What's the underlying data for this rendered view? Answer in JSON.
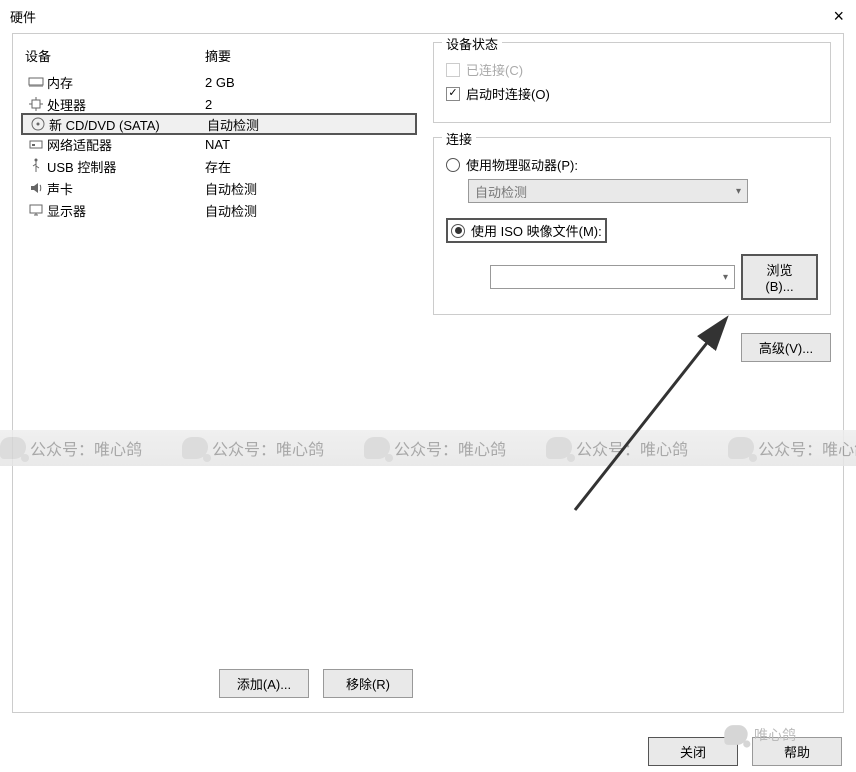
{
  "window": {
    "title": "硬件",
    "close": "×"
  },
  "deviceTable": {
    "head_device": "设备",
    "head_summary": "摘要",
    "rows": [
      {
        "icon": "memory-icon",
        "name": "内存",
        "summary": "2 GB"
      },
      {
        "icon": "cpu-icon",
        "name": "处理器",
        "summary": "2"
      },
      {
        "icon": "disc-icon",
        "name": "新 CD/DVD (SATA)",
        "summary": "自动检测",
        "selected": true
      },
      {
        "icon": "network-icon",
        "name": "网络适配器",
        "summary": "NAT"
      },
      {
        "icon": "usb-icon",
        "name": "USB 控制器",
        "summary": "存在"
      },
      {
        "icon": "sound-icon",
        "name": "声卡",
        "summary": "自动检测"
      },
      {
        "icon": "display-icon",
        "name": "显示器",
        "summary": "自动检测"
      }
    ]
  },
  "leftButtons": {
    "add": "添加(A)...",
    "remove": "移除(R)"
  },
  "status": {
    "legend": "设备状态",
    "connected": "已连接(C)",
    "connect_at_poweron": "启动时连接(O)"
  },
  "connection": {
    "legend": "连接",
    "use_physical": "使用物理驱动器(P):",
    "physical_combo": "自动检测",
    "use_iso": "使用 ISO 映像文件(M):",
    "iso_path": "",
    "browse": "浏览(B)..."
  },
  "advanced": "高级(V)...",
  "bottom": {
    "close": "关闭",
    "help": "帮助"
  },
  "watermark": {
    "text": "公众号：唯心鸽",
    "corner": "唯心鸽"
  }
}
